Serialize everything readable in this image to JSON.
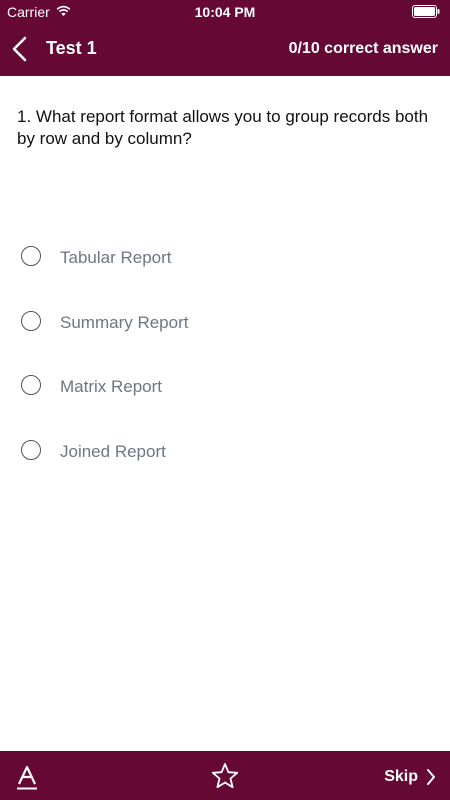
{
  "status_bar": {
    "carrier": "Carrier",
    "time": "10:04 PM"
  },
  "nav": {
    "title": "Test 1",
    "score": "0/10 correct answer",
    "back_icon": "chevron-left-icon"
  },
  "question": {
    "text": "1. What report format allows you to group records both by row and by column?"
  },
  "options": [
    {
      "label": "Tabular Report"
    },
    {
      "label": "Summary Report"
    },
    {
      "label": "Matrix Report"
    },
    {
      "label": "Joined Report"
    }
  ],
  "bottom_bar": {
    "font_icon": "font-size-icon",
    "star_icon": "star-icon",
    "skip_label": "Skip"
  },
  "colors": {
    "bar_background": "#650834",
    "option_text": "#6e7682"
  }
}
